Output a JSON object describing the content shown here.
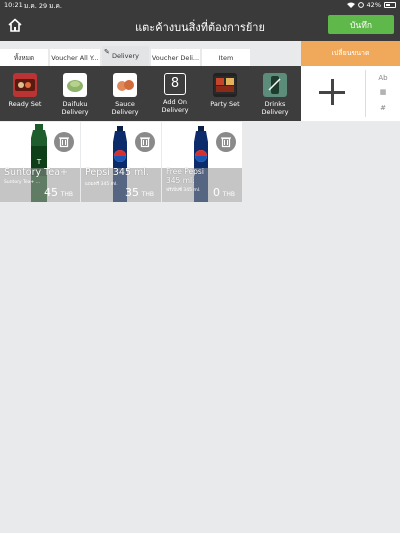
{
  "status_bar": {
    "time": "10:21",
    "date": "ม.ค. 29 ม.ค.",
    "battery": "42%"
  },
  "header": {
    "title": "แตะค้างบนสิ่งที่ต้องการย้าย",
    "save_label": "บันทึก"
  },
  "tabs": [
    {
      "label": "ทั้งหมด",
      "active": false
    },
    {
      "label": "Voucher All Y...",
      "active": false
    },
    {
      "label": "Delivery",
      "active": true
    },
    {
      "label": "Voucher Deli...",
      "active": false
    },
    {
      "label": "Item",
      "active": false
    }
  ],
  "resize_label": "เปลี่ยนขนาด",
  "categories": [
    {
      "label": "Ready Set",
      "icon": "ready-set-image"
    },
    {
      "label": "Daifuku\nDelivery",
      "icon": "daifuku-image"
    },
    {
      "label": "Sauce\nDelivery",
      "icon": "sauce-image"
    },
    {
      "label": "Add On\nDelivery",
      "number": "8"
    },
    {
      "label": "Party Set",
      "icon": "party-set-image"
    },
    {
      "label": "Drinks\nDelivery",
      "icon": "drinks-image"
    }
  ],
  "add_panel": {
    "options": [
      "Ab",
      "▦",
      "#"
    ]
  },
  "products": [
    {
      "name": "Suntory Tea+",
      "subtitle": "Suntory Tea+ ...",
      "price": "45",
      "unit": "THB",
      "bottle_color": "#1f5e2c"
    },
    {
      "name": "Pepsi 345 ml.",
      "subtitle": "แถมฟรี 345 ml.",
      "price": "35",
      "unit": "THB",
      "bottle_color": "#0b2b6b"
    },
    {
      "name": "Free Pepsi\n345 ml.",
      "subtitle": "ฟรีเป๊ปซี่ 345 ml.",
      "price": "0",
      "unit": "THB",
      "bottle_color": "#0b2b6b"
    }
  ],
  "colors": {
    "header": "#3a3a3a",
    "save": "#5fb84a",
    "resize": "#f0a95a",
    "background": "#e9eaec"
  }
}
